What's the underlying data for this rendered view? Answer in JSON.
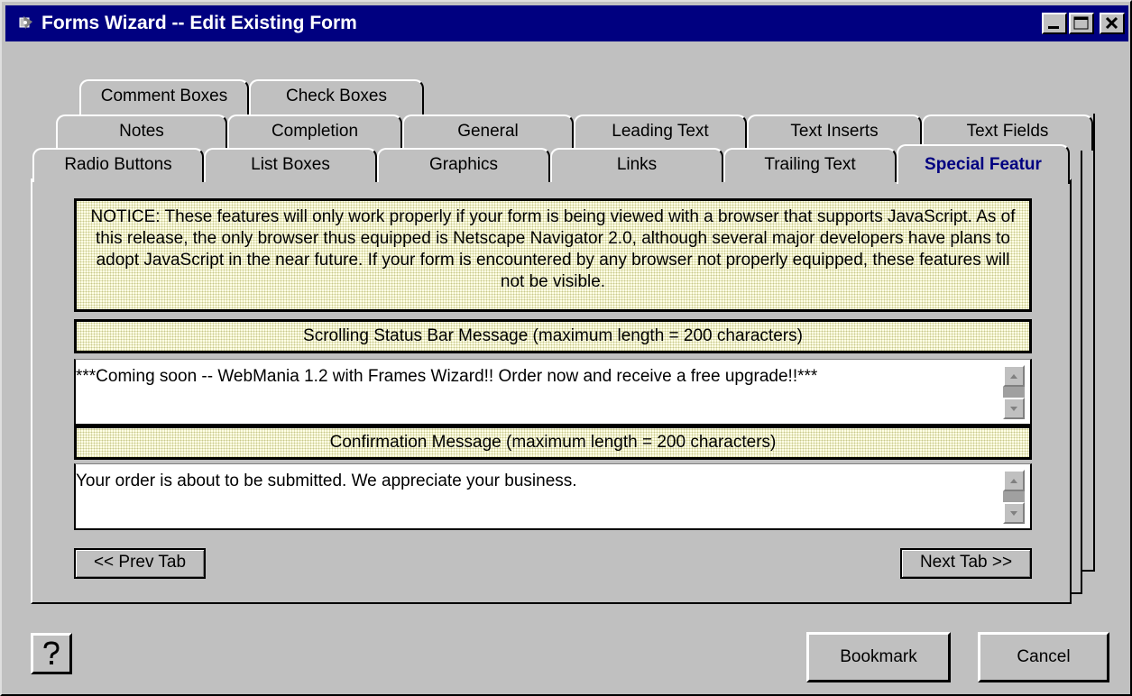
{
  "window": {
    "title": "Forms Wizard -- Edit Existing Form"
  },
  "tabs": {
    "row1": [
      "Comment Boxes",
      "Check Boxes"
    ],
    "row2": [
      "Notes",
      "Completion",
      "General",
      "Leading Text",
      "Text Inserts",
      "Text Fields"
    ],
    "row3": [
      "Radio Buttons",
      "List Boxes",
      "Graphics",
      "Links",
      "Trailing Text",
      "Special Featur"
    ],
    "active": "Special Featur"
  },
  "notice": {
    "text": "NOTICE: These features will only work properly if your form is being viewed with a browser that supports JavaScript.  As of this release, the only browser thus equipped is Netscape Navigator 2.0, although several major developers have plans to adopt JavaScript in the near future.  If your form is encountered by any browser not properly equipped, these features will not be visible."
  },
  "status_bar": {
    "label": "Scrolling Status Bar Message (maximum length = 200 characters)",
    "value": "***Coming soon -- WebMania 1.2 with Frames Wizard!!   Order now and receive a free upgrade!!***"
  },
  "confirmation": {
    "label": "Confirmation Message (maximum length = 200 characters)",
    "value": "Your order is about to be submitted.  We appreciate your business."
  },
  "buttons": {
    "prev_tab": "<< Prev Tab",
    "next_tab": "Next Tab >>",
    "help": "?",
    "bookmark": "Bookmark",
    "cancel": "Cancel"
  },
  "colors": {
    "titlebar": "#000080",
    "face": "#c0c0c0",
    "notice_bg": "#ffffe6",
    "active_tab_text": "#000080"
  }
}
